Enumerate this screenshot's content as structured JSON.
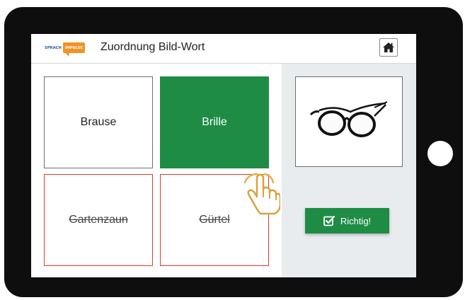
{
  "logo": {
    "part_a": "SPRACH",
    "part_b": "IMPULSE"
  },
  "header": {
    "title": "Zuordnung Bild-Wort",
    "home_icon": "house-icon"
  },
  "tiles": [
    {
      "label": "Brause",
      "state": "neutral"
    },
    {
      "label": "Brille",
      "state": "selected"
    },
    {
      "label": "Gartenzaun",
      "state": "wrong"
    },
    {
      "label": "Gürtel",
      "state": "wrong"
    }
  ],
  "picture": {
    "icon": "glasses-image"
  },
  "feedback": {
    "label": "Richtig!",
    "icon": "checkbox-check-icon"
  },
  "pointer": {
    "icon": "pointing-hand-icon"
  },
  "colors": {
    "correct_green": "#1e8c45",
    "wrong_red": "#e53a2c",
    "logo_orange": "#f39323",
    "logo_blue": "#1a5aa0",
    "side_panel": "#e8ecef"
  }
}
